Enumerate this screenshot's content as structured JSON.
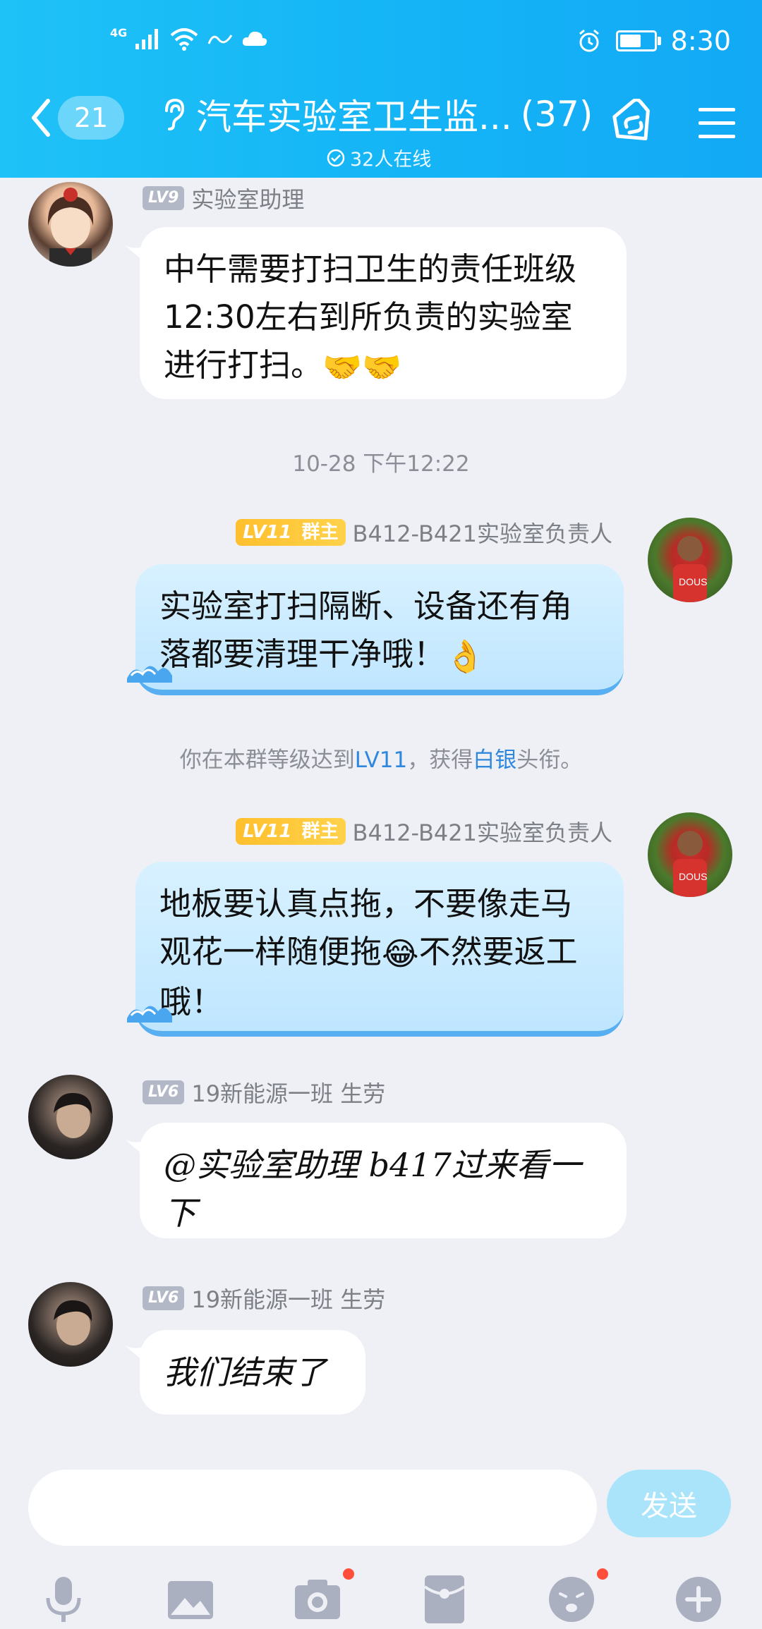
{
  "status_bar": {
    "network": "4G",
    "time": "8:30",
    "battery_level": 0.62
  },
  "header": {
    "unread_count": "21",
    "title": "汽车实验室卫生监...",
    "member_count": "(37)",
    "online_text": "32人在线"
  },
  "messages": [
    {
      "level": "LV9",
      "sender": "实验室助理",
      "text": "中午需要打扫卫生的责任班级12:30左右到所负责的实验室进行打扫。",
      "emoji": "🤝🤝"
    },
    {
      "timestamp": "10-28 下午12:22"
    },
    {
      "owner_level": "LV11",
      "owner_label": "群主",
      "sender": "B412-B421实验室负责人",
      "text": "实验室打扫隔断、设备还有角落都要清理干净哦！",
      "emoji": "👌"
    },
    {
      "system_prefix": "你在本群等级达到",
      "system_link1": "LV11",
      "system_mid": "，获得",
      "system_link2": "白银",
      "system_suffix": "头衔。"
    },
    {
      "owner_level": "LV11",
      "owner_label": "群主",
      "sender": "B412-B421实验室负责人",
      "text_part1": "地板要认真点拖，不要像走马观花一样随便拖",
      "emoji": "😂",
      "text_part2": "不然要返工哦！"
    },
    {
      "level": "LV6",
      "sender": "19新能源一班  生劳",
      "text": "@实验室助理 b417过来看一下"
    },
    {
      "level": "LV6",
      "sender": "19新能源一班  生劳",
      "text": "我们结束了"
    }
  ],
  "input": {
    "placeholder": "",
    "send_label": "发送"
  },
  "toolbar_icons": [
    "microphone-icon",
    "image-icon",
    "camera-icon",
    "red-packet-icon",
    "emoji-icon",
    "plus-icon"
  ]
}
